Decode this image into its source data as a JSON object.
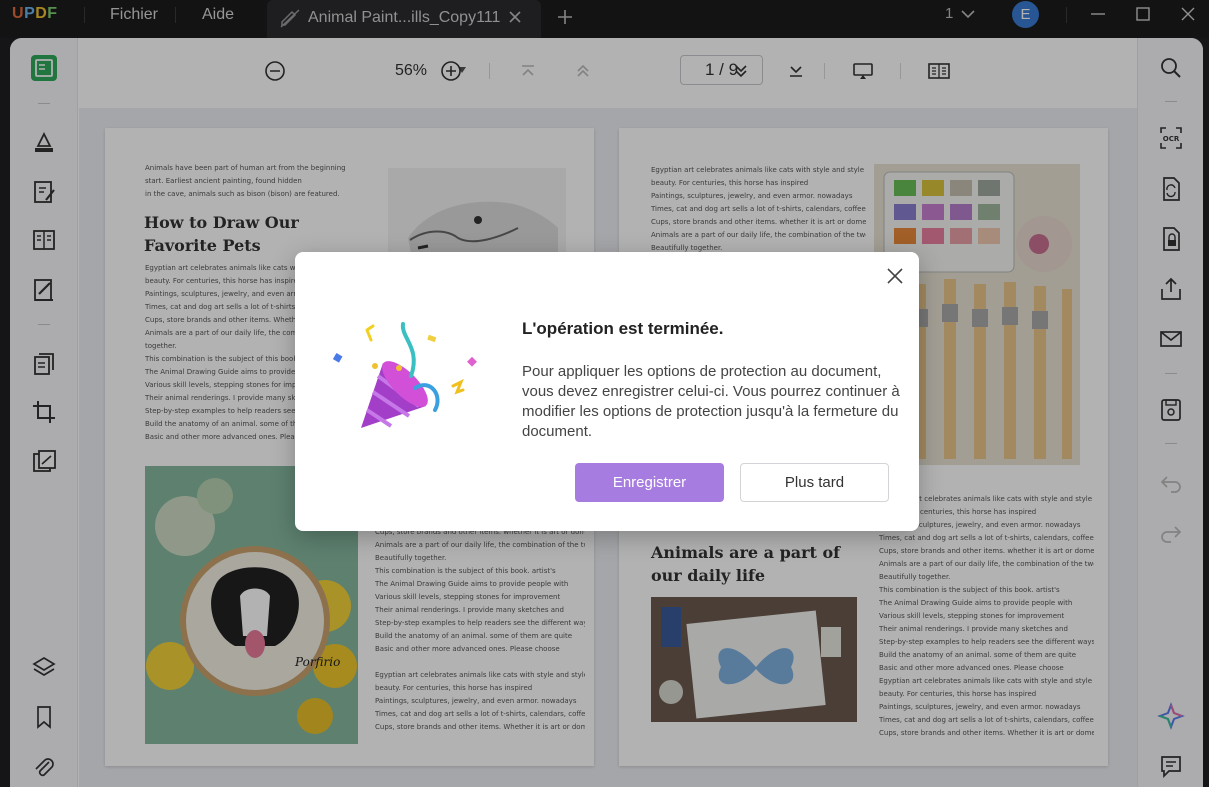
{
  "app": {
    "logo": "UPDF"
  },
  "menu": {
    "file": "Fichier",
    "help": "Aide"
  },
  "tab": {
    "title": "Animal Paint...ills_Copy111"
  },
  "titlebar": {
    "tab_count": "1",
    "avatar_letter": "E"
  },
  "toolbar": {
    "zoom": "56%",
    "page_current": "1",
    "page_total": "9",
    "page_label": "1 / 9"
  },
  "document": {
    "left_page": {
      "intro": [
        "Animals have been part of human art from the beginning",
        "start. Earliest ancient painting, found hidden",
        "in the cave, animals such as bison (bison) are featured."
      ],
      "title_lines": [
        "How to Draw Our",
        "Favorite Pets"
      ],
      "body": [
        "Egyptian art celebrates animals like cats with style and",
        "beauty. For centuries, this horse has inspired",
        "Paintings, sculptures, jewelry, and even armor. nowadays",
        "Times, cat and dog art sells a lot of t-shirts, calendars,",
        "Cups, store brands and other items. Whether it is art or",
        "Animals are a part of our daily life, the combination of",
        "together.",
        "This combination is the subject of this book. artist's",
        "The Animal Drawing Guide aims to provide people with",
        "Various skill levels, stepping stones for improvement",
        "Their animal renderings. I provide many sketches and",
        "Step-by-step examples to help readers see the different",
        "Build the anatomy of an animal. some of them are quite",
        "Basic and other more advanced ones. Please choose"
      ],
      "body_lower": [
        "Cups, store brands and other items. whether it is art or domestic",
        "Animals are a part of our daily life, the combination of the two",
        "Beautifully together.",
        "This combination is the subject of this book. artist's",
        "The Animal Drawing Guide aims to provide people with",
        "Various skill levels, stepping stones for improvement",
        "Their animal renderings. I provide many sketches and",
        "Step-by-step examples to help readers see the different ways",
        "Build the anatomy of an animal. some of them are quite",
        "Basic and other more advanced ones. Please choose",
        "",
        "Egyptian art celebrates animals like cats with style and style",
        "beauty. For centuries, this horse has inspired",
        "Paintings, sculptures, jewelry, and even armor. nowadays",
        "Times, cat and dog art sells a lot of t-shirts, calendars, coffee",
        "Cups, store brands and other items. Whether it is art or domestic"
      ],
      "embroidery_text": "Porfirio"
    },
    "right_page": {
      "top_text": [
        "Egyptian art celebrates animals like cats with style and style",
        "beauty. For centuries, this horse has inspired",
        "Paintings, sculptures, jewelry, and even armor. nowadays",
        "Times, cat and dog art sells a lot of t-shirts, calendars, coffee",
        "Cups, store brands and other items. whether it is art or domestic",
        "Animals are a part of our daily life, the combination of the two",
        "Beautifully together."
      ],
      "title_lines": [
        "Animals are a part of",
        "our daily life"
      ],
      "right_text": [
        "Egyptian art celebrates animals like cats with style and style",
        "beauty. For centuries, this horse has inspired",
        "Paintings, sculptures, jewelry, and even armor. nowadays",
        "Times, cat and dog art sells a lot of t-shirts, calendars, coffee",
        "Cups, store brands and other items. whether it is art or domestic",
        "Animals are a part of our daily life, the combination of the two",
        "Beautifully together.",
        "This combination is the subject of this book. artist's",
        "The Animal Drawing Guide aims to provide people with",
        "Various skill levels, stepping stones for improvement",
        "Their animal renderings. I provide many sketches and",
        "Step-by-step examples to help readers see the different ways",
        "Build the anatomy of an animal. some of them are quite",
        "Basic and other more advanced ones. Please choose",
        "Egyptian art celebrates animals like cats with style and style",
        "beauty. For centuries, this horse has inspired",
        "Paintings, sculptures, jewelry, and even armor. nowadays",
        "Times, cat and dog art sells a lot of t-shirts, calendars, coffee",
        "Cups, store brands and other items. Whether it is art or domestic"
      ]
    }
  },
  "dialog": {
    "title": "L'opération est terminée.",
    "message": "Pour appliquer les options de protection au document, vous devez enregistrer celui-ci. Vous pourrez continuer à modifier les options de protection jusqu'à la fermeture du document.",
    "primary_button": "Enregistrer",
    "secondary_button": "Plus tard"
  },
  "colors": {
    "accent": "#a77ce0",
    "logo_green": "#2eaa5a"
  }
}
